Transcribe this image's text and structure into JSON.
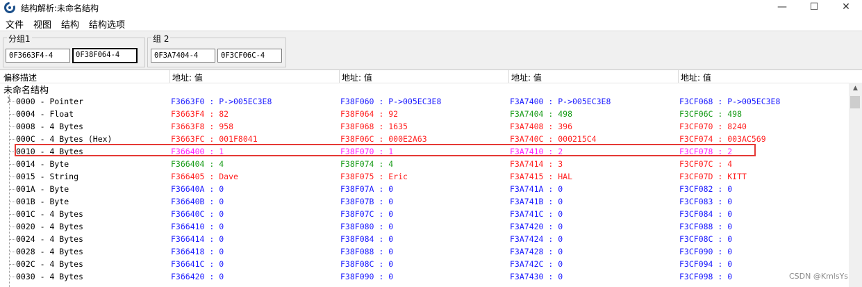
{
  "window": {
    "title": "结构解析:未命名结构",
    "min_glyph": "—",
    "max_glyph": "☐",
    "close_glyph": "✕"
  },
  "menu": [
    "文件",
    "视图",
    "结构",
    "结构选项"
  ],
  "groups": [
    {
      "label": "分组1",
      "addresses": [
        "0F3663F4-4",
        "0F38F064-4"
      ]
    },
    {
      "label": "组 2",
      "addresses": [
        "0F3A7404-4",
        "0F3CF06C-4"
      ]
    }
  ],
  "columns": {
    "offset_header": "偏移描述",
    "value_headers": [
      "地址: 值",
      "地址: 值",
      "地址: 值",
      "地址: 值"
    ]
  },
  "struct_name": "未命名结构",
  "colors": {
    "blue": "#1a1aff",
    "red": "#ff2020",
    "green": "#159a15",
    "magenta": "#ff20ff",
    "highlight": "#e53935"
  },
  "rows": [
    {
      "offset": "0000 - Pointer",
      "cells": [
        {
          "text": "F3663F0 : P->005EC3E8",
          "color": "blue"
        },
        {
          "text": "F38F060 : P->005EC3E8",
          "color": "blue"
        },
        {
          "text": "F3A7400 : P->005EC3E8",
          "color": "blue"
        },
        {
          "text": "F3CF068 : P->005EC3E8",
          "color": "blue"
        }
      ]
    },
    {
      "offset": "0004 - Float",
      "cells": [
        {
          "text": "F3663F4 : 82",
          "color": "red"
        },
        {
          "text": "F38F064 : 92",
          "color": "red"
        },
        {
          "text": "F3A7404 : 498",
          "color": "green"
        },
        {
          "text": "F3CF06C : 498",
          "color": "green"
        }
      ]
    },
    {
      "offset": "0008 - 4 Bytes",
      "cells": [
        {
          "text": "F3663F8 : 958",
          "color": "red"
        },
        {
          "text": "F38F068 : 1635",
          "color": "red"
        },
        {
          "text": "F3A7408 : 396",
          "color": "red"
        },
        {
          "text": "F3CF070 : 8240",
          "color": "red"
        }
      ]
    },
    {
      "offset": "000C - 4 Bytes (Hex)",
      "cells": [
        {
          "text": "F3663FC : 001F8041",
          "color": "red"
        },
        {
          "text": "F38F06C : 000E2A63",
          "color": "red"
        },
        {
          "text": "F3A740C : 000215C4",
          "color": "red"
        },
        {
          "text": "F3CF074 : 003AC569",
          "color": "red"
        }
      ]
    },
    {
      "offset": "0010 - 4 Bytes",
      "cells": [
        {
          "text": "F366400 : 1",
          "color": "magenta"
        },
        {
          "text": "F38F070 : 1",
          "color": "magenta"
        },
        {
          "text": "F3A7410 : 2",
          "color": "magenta"
        },
        {
          "text": "F3CF078 : 2",
          "color": "magenta"
        }
      ]
    },
    {
      "offset": "0014 - Byte",
      "cells": [
        {
          "text": "F366404 : 4",
          "color": "green"
        },
        {
          "text": "F38F074 : 4",
          "color": "green"
        },
        {
          "text": "F3A7414 : 3",
          "color": "red"
        },
        {
          "text": "F3CF07C : 4",
          "color": "red"
        }
      ]
    },
    {
      "offset": "0015 - String",
      "cells": [
        {
          "text": "F366405 : Dave",
          "color": "red"
        },
        {
          "text": "F38F075 : Eric",
          "color": "red"
        },
        {
          "text": "F3A7415 : HAL",
          "color": "red"
        },
        {
          "text": "F3CF07D : KITT",
          "color": "red"
        }
      ]
    },
    {
      "offset": "001A - Byte",
      "cells": [
        {
          "text": "F36640A : 0",
          "color": "blue"
        },
        {
          "text": "F38F07A : 0",
          "color": "blue"
        },
        {
          "text": "F3A741A : 0",
          "color": "blue"
        },
        {
          "text": "F3CF082 : 0",
          "color": "blue"
        }
      ]
    },
    {
      "offset": "001B - Byte",
      "cells": [
        {
          "text": "F36640B : 0",
          "color": "blue"
        },
        {
          "text": "F38F07B : 0",
          "color": "blue"
        },
        {
          "text": "F3A741B : 0",
          "color": "blue"
        },
        {
          "text": "F3CF083 : 0",
          "color": "blue"
        }
      ]
    },
    {
      "offset": "001C - 4 Bytes",
      "cells": [
        {
          "text": "F36640C : 0",
          "color": "blue"
        },
        {
          "text": "F38F07C : 0",
          "color": "blue"
        },
        {
          "text": "F3A741C : 0",
          "color": "blue"
        },
        {
          "text": "F3CF084 : 0",
          "color": "blue"
        }
      ]
    },
    {
      "offset": "0020 - 4 Bytes",
      "cells": [
        {
          "text": "F366410 : 0",
          "color": "blue"
        },
        {
          "text": "F38F080 : 0",
          "color": "blue"
        },
        {
          "text": "F3A7420 : 0",
          "color": "blue"
        },
        {
          "text": "F3CF088 : 0",
          "color": "blue"
        }
      ]
    },
    {
      "offset": "0024 - 4 Bytes",
      "cells": [
        {
          "text": "F366414 : 0",
          "color": "blue"
        },
        {
          "text": "F38F084 : 0",
          "color": "blue"
        },
        {
          "text": "F3A7424 : 0",
          "color": "blue"
        },
        {
          "text": "F3CF08C : 0",
          "color": "blue"
        }
      ]
    },
    {
      "offset": "0028 - 4 Bytes",
      "cells": [
        {
          "text": "F366418 : 0",
          "color": "blue"
        },
        {
          "text": "F38F088 : 0",
          "color": "blue"
        },
        {
          "text": "F3A7428 : 0",
          "color": "blue"
        },
        {
          "text": "F3CF090 : 0",
          "color": "blue"
        }
      ]
    },
    {
      "offset": "002C - 4 Bytes",
      "cells": [
        {
          "text": "F36641C : 0",
          "color": "blue"
        },
        {
          "text": "F38F08C : 0",
          "color": "blue"
        },
        {
          "text": "F3A742C : 0",
          "color": "blue"
        },
        {
          "text": "F3CF094 : 0",
          "color": "blue"
        }
      ]
    },
    {
      "offset": "0030 - 4 Bytes",
      "cells": [
        {
          "text": "F366420 : 0",
          "color": "blue"
        },
        {
          "text": "F38F090 : 0",
          "color": "blue"
        },
        {
          "text": "F3A7430 : 0",
          "color": "blue"
        },
        {
          "text": "F3CF098 : 0",
          "color": "blue"
        }
      ]
    }
  ],
  "watermark": "CSDN @KmlsYs"
}
